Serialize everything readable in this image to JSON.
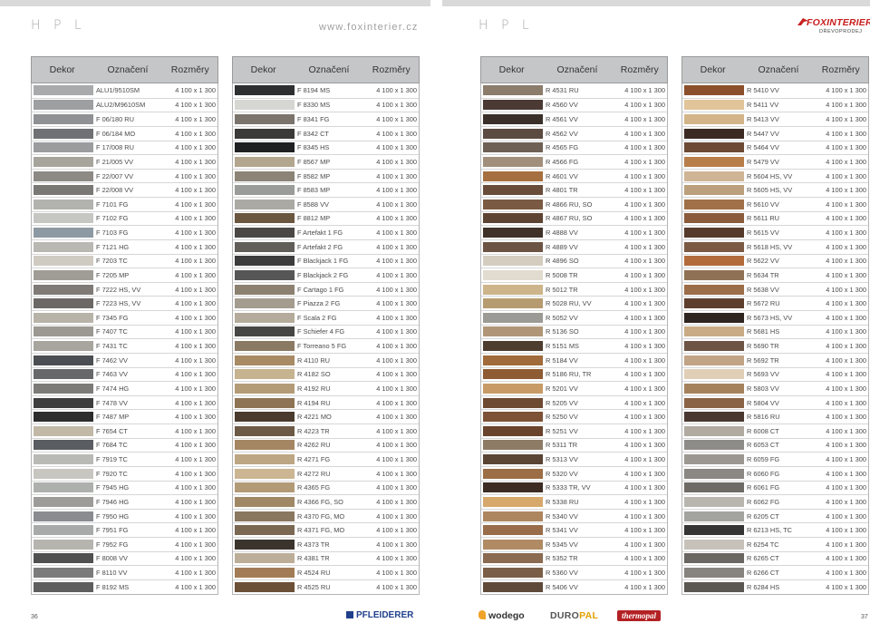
{
  "header": {
    "left_title": "H P L",
    "site_url": "www.foxinterier.cz",
    "right_title": "H P L",
    "logo_text": "FOXINTERIER",
    "logo_subtext": "DŘEVOPRODEJ"
  },
  "columns_header": {
    "decor": "Dekor",
    "code": "Označení",
    "size": "Rozměry"
  },
  "size_value": "4 100 x 1 300",
  "columns": [
    {
      "rows": [
        {
          "code": "ALU1/9510SM",
          "color": "#a9aaac"
        },
        {
          "code": "ALU2/M9610SM",
          "color": "#9e9fa1"
        },
        {
          "code": "F 06/180 RU",
          "color": "#8f9194"
        },
        {
          "code": "F 06/184 MO",
          "color": "#6f7174"
        },
        {
          "code": "F 17/008 RU",
          "color": "#9a9c9e"
        },
        {
          "code": "F 21/005 VV",
          "color": "#a7a49c"
        },
        {
          "code": "F 22/007 VV",
          "color": "#8d8a86"
        },
        {
          "code": "F 22/008 VV",
          "color": "#7a7875"
        },
        {
          "code": "F 7101 FG",
          "color": "#b2b2ae"
        },
        {
          "code": "F 7102 FG",
          "color": "#c6c7c2"
        },
        {
          "code": "F 7103 FG",
          "color": "#8e9aa3"
        },
        {
          "code": "F 7121 HG",
          "color": "#b9b8b3"
        },
        {
          "code": "F 7203 TC",
          "color": "#cfcbc2"
        },
        {
          "code": "F 7205 MP",
          "color": "#a09d97"
        },
        {
          "code": "F 7222 HS, VV",
          "color": "#7f7a76"
        },
        {
          "code": "F 7223 HS, VV",
          "color": "#6c6866"
        },
        {
          "code": "F 7345 FG",
          "color": "#b7b3a8"
        },
        {
          "code": "F 7407 TC",
          "color": "#9c9892"
        },
        {
          "code": "F 7431 TC",
          "color": "#a8a59f"
        },
        {
          "code": "F 7462 VV",
          "color": "#4b4e52"
        },
        {
          "code": "F 7463 VV",
          "color": "#66686a"
        },
        {
          "code": "F 7474 HG",
          "color": "#7d7b78"
        },
        {
          "code": "F 7478 VV",
          "color": "#3e3e3e"
        },
        {
          "code": "F 7487 MP",
          "color": "#2d2d2d"
        },
        {
          "code": "F 7654 CT",
          "color": "#c2b8a7"
        },
        {
          "code": "F 7684 TC",
          "color": "#5a5d61"
        },
        {
          "code": "F 7919 TC",
          "color": "#b9b9b6"
        },
        {
          "code": "F 7920 TC",
          "color": "#c8c6c0"
        },
        {
          "code": "F 7945 HG",
          "color": "#aeb0ae"
        },
        {
          "code": "F 7946 HG",
          "color": "#9e9c98"
        },
        {
          "code": "F 7950 HG",
          "color": "#8a8c90"
        },
        {
          "code": "F 7951 FG",
          "color": "#a8aaa9"
        },
        {
          "code": "F 7952 FG",
          "color": "#b6b4ae"
        },
        {
          "code": "F 8008 VV",
          "color": "#505050"
        },
        {
          "code": "F 8110 VV",
          "color": "#7b7b7b"
        },
        {
          "code": "F 8192 MS",
          "color": "#5e5e5e"
        }
      ]
    },
    {
      "rows": [
        {
          "code": "F 8194 MS",
          "color": "#2e2f30"
        },
        {
          "code": "F 8330 MS",
          "color": "#d6d6d3"
        },
        {
          "code": "F 8341 FG",
          "color": "#7b746d"
        },
        {
          "code": "F 8342 CT",
          "color": "#3b3a38"
        },
        {
          "code": "F 8345 HS",
          "color": "#1f2022"
        },
        {
          "code": "F 8567 MP",
          "color": "#b3a68e"
        },
        {
          "code": "F 8582 MP",
          "color": "#8b8477"
        },
        {
          "code": "F 8583 MP",
          "color": "#9a9c99"
        },
        {
          "code": "F 8588 VV",
          "color": "#aaa9a4"
        },
        {
          "code": "F 8812 MP",
          "color": "#6b5640"
        },
        {
          "code": "F Artefakt 1 FG",
          "color": "#4a4745"
        },
        {
          "code": "F Artefakt 2 FG",
          "color": "#615d59"
        },
        {
          "code": "F Blackjack 1 FG",
          "color": "#3c3c3c"
        },
        {
          "code": "F Blackjack 2 FG",
          "color": "#565656"
        },
        {
          "code": "F Cartago 1 FG",
          "color": "#8c8071"
        },
        {
          "code": "F Piazza 2 FG",
          "color": "#a49c8f"
        },
        {
          "code": "F Scala 2 FG",
          "color": "#b4ab9c"
        },
        {
          "code": "F Schiefer 4 FG",
          "color": "#464644"
        },
        {
          "code": "F Torreano 5 FG",
          "color": "#8b7a63"
        },
        {
          "code": "R 4110 RU",
          "color": "#a88a64"
        },
        {
          "code": "R 4182 SO",
          "color": "#c6b38f"
        },
        {
          "code": "R 4192 RU",
          "color": "#b39b78"
        },
        {
          "code": "R 4194 RU",
          "color": "#8e7454"
        },
        {
          "code": "R 4221 MO",
          "color": "#4a3b2e"
        },
        {
          "code": "R 4223 TR",
          "color": "#6d5a46"
        },
        {
          "code": "R 4262 RU",
          "color": "#a58663"
        },
        {
          "code": "R 4271 FG",
          "color": "#bda684"
        },
        {
          "code": "R 4272 RU",
          "color": "#cbb592"
        },
        {
          "code": "R 4365 FG",
          "color": "#b39a77"
        },
        {
          "code": "R 4366 FG, SO",
          "color": "#a08866"
        },
        {
          "code": "R 4370 FG, MO",
          "color": "#8a7760"
        },
        {
          "code": "R 4371 FG, MO",
          "color": "#7a6852"
        },
        {
          "code": "R 4373 TR",
          "color": "#3b342d"
        },
        {
          "code": "R 4381 TR",
          "color": "#bcae99"
        },
        {
          "code": "R 4524 RU",
          "color": "#a27c56"
        },
        {
          "code": "R 4525 RU",
          "color": "#6c4f37"
        }
      ]
    },
    {
      "rows": [
        {
          "code": "R 4531 RU",
          "color": "#8b7c6c"
        },
        {
          "code": "R 4560 VV",
          "color": "#4a3a33"
        },
        {
          "code": "R 4561 VV",
          "color": "#3b2f2a"
        },
        {
          "code": "R 4562 VV",
          "color": "#5c4b40"
        },
        {
          "code": "R 4565 FG",
          "color": "#6e6055"
        },
        {
          "code": "R 4566 FG",
          "color": "#a18f7c"
        },
        {
          "code": "R 4601 VV",
          "color": "#a66f3f"
        },
        {
          "code": "R 4801 TR",
          "color": "#6a4c3a"
        },
        {
          "code": "R 4866 RU, SO",
          "color": "#7a5a43"
        },
        {
          "code": "R 4867 RU, SO",
          "color": "#5d4333"
        },
        {
          "code": "R 4888 VV",
          "color": "#3f3128"
        },
        {
          "code": "R 4889 VV",
          "color": "#6c5445"
        },
        {
          "code": "R 4896 SO",
          "color": "#d4cdbf"
        },
        {
          "code": "R 5008 TR",
          "color": "#e1dccf"
        },
        {
          "code": "R 5012 TR",
          "color": "#cdb48a"
        },
        {
          "code": "R 5028 RU, VV",
          "color": "#b79b70"
        },
        {
          "code": "R 5052 VV",
          "color": "#9c9a95"
        },
        {
          "code": "R 5136 SO",
          "color": "#b09677"
        },
        {
          "code": "R 5151 MS",
          "color": "#4e3d2f"
        },
        {
          "code": "R 5184 VV",
          "color": "#a06a3b"
        },
        {
          "code": "R 5186 RU, TR",
          "color": "#8e5b33"
        },
        {
          "code": "R 5201 VV",
          "color": "#c79a66"
        },
        {
          "code": "R 5205 VV",
          "color": "#6e4a33"
        },
        {
          "code": "R 5250 VV",
          "color": "#7d5237"
        },
        {
          "code": "R 5251 VV",
          "color": "#6a432c"
        },
        {
          "code": "R 5311 TR",
          "color": "#8d7b66"
        },
        {
          "code": "R 5313 VV",
          "color": "#5a4434"
        },
        {
          "code": "R 5320 VV",
          "color": "#9b6e46"
        },
        {
          "code": "R 5333 TR, VV",
          "color": "#3d2c23"
        },
        {
          "code": "R 5338 RU",
          "color": "#d6a86c"
        },
        {
          "code": "R 5340 VV",
          "color": "#ad8660"
        },
        {
          "code": "R 5341 VV",
          "color": "#996d4a"
        },
        {
          "code": "R 5345 VV",
          "color": "#b08a63"
        },
        {
          "code": "R 5352 TR",
          "color": "#8a6a50"
        },
        {
          "code": "R 5360 VV",
          "color": "#7b5e47"
        },
        {
          "code": "R 5406 VV",
          "color": "#5f4a3a"
        }
      ]
    },
    {
      "rows": [
        {
          "code": "R 5410 VV",
          "color": "#8c4f2c"
        },
        {
          "code": "R 5411 VV",
          "color": "#e2c49a"
        },
        {
          "code": "R 5413 VV",
          "color": "#d3b488"
        },
        {
          "code": "R 5447 VV",
          "color": "#3c2a22"
        },
        {
          "code": "R 5464 VV",
          "color": "#6c4a34"
        },
        {
          "code": "R 5479 VV",
          "color": "#b87e4a"
        },
        {
          "code": "R 5604 HS, VV",
          "color": "#cfb595"
        },
        {
          "code": "R 5605 HS, VV",
          "color": "#bca07d"
        },
        {
          "code": "R 5610 VV",
          "color": "#a07048"
        },
        {
          "code": "R 5611 RU",
          "color": "#8a5c3c"
        },
        {
          "code": "R 5615 VV",
          "color": "#563a2b"
        },
        {
          "code": "R 5618 HS, VV",
          "color": "#7b5943"
        },
        {
          "code": "R 5622 VV",
          "color": "#b36b3c"
        },
        {
          "code": "R 5634 TR",
          "color": "#8f7155"
        },
        {
          "code": "R 5638 VV",
          "color": "#9b6d49"
        },
        {
          "code": "R 5672 RU",
          "color": "#5e3f2e"
        },
        {
          "code": "R 5673 HS, VV",
          "color": "#2f2520"
        },
        {
          "code": "R 5681 HS",
          "color": "#c9ac86"
        },
        {
          "code": "R 5690 TR",
          "color": "#6d5444"
        },
        {
          "code": "R 5692 TR",
          "color": "#c1a386"
        },
        {
          "code": "R 5693 VV",
          "color": "#e0cfb6"
        },
        {
          "code": "R 5803 VV",
          "color": "#a6825c"
        },
        {
          "code": "R 5804 VV",
          "color": "#8a6346"
        },
        {
          "code": "R 5816 RU",
          "color": "#4a3830"
        },
        {
          "code": "R 6008 CT",
          "color": "#b0aaa0"
        },
        {
          "code": "R 6053 CT",
          "color": "#8e8c89"
        },
        {
          "code": "R 6059 FG",
          "color": "#9c9790"
        },
        {
          "code": "R 6060 FG",
          "color": "#8b8782"
        },
        {
          "code": "R 6061 FG",
          "color": "#6e6a66"
        },
        {
          "code": "R 6062 FG",
          "color": "#b9b6b0"
        },
        {
          "code": "R 6205 CT",
          "color": "#a3a39f"
        },
        {
          "code": "R 6213 HS, TC",
          "color": "#353535"
        },
        {
          "code": "R 6254 TC",
          "color": "#c6c2ba"
        },
        {
          "code": "R 6265 CT",
          "color": "#6a6662"
        },
        {
          "code": "R 6266 CT",
          "color": "#87837e"
        },
        {
          "code": "R 6284 HS",
          "color": "#5a5652"
        }
      ]
    }
  ],
  "footer": {
    "page_left": "36",
    "page_right": "37",
    "brands": {
      "pfleiderer": "PFLEIDERER",
      "wodego": "wodego",
      "duropal_a": "DURO",
      "duropal_b": "PAL",
      "thermopal": "thermopal"
    }
  }
}
